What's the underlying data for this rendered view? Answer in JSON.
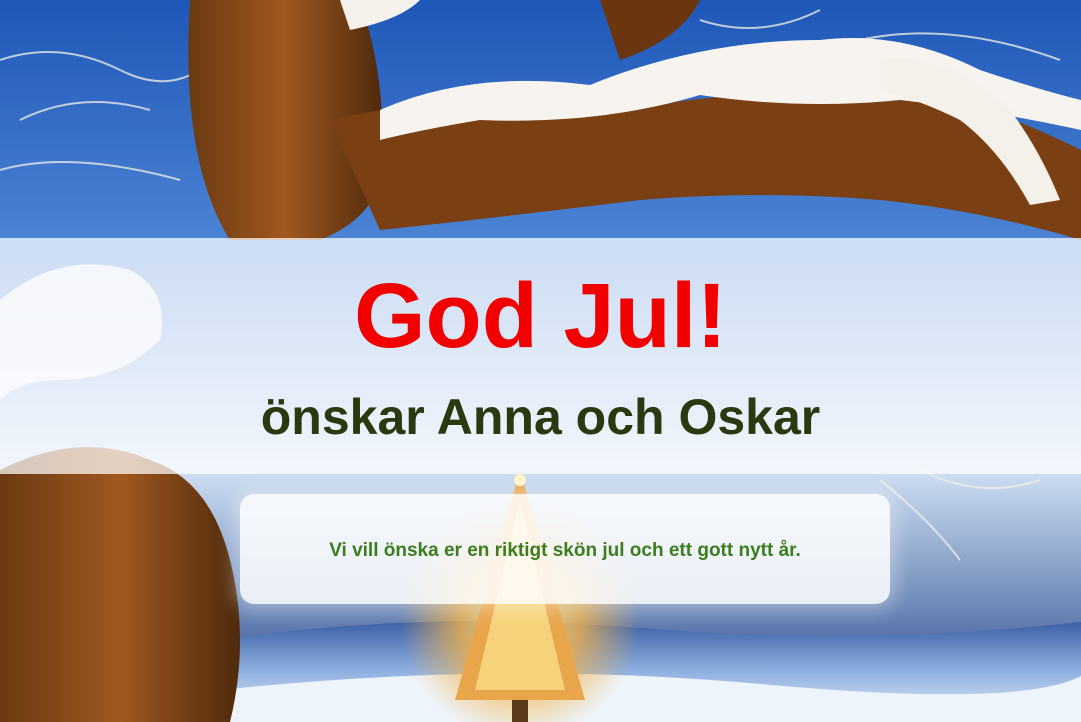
{
  "greeting": {
    "title": "God Jul!",
    "subtitle": "önskar Anna och Oskar"
  },
  "message": {
    "text": "Vi vill önska er en riktigt skön jul och ett gott nytt år."
  },
  "colors": {
    "title": "#f20000",
    "subtitle": "#2a3a10",
    "message": "#3b7d1f",
    "sky": "#2a5fb0"
  },
  "scene": {
    "description_icons": [
      "snowy-tree-icon",
      "christmas-tree-icon",
      "snow-field-icon"
    ]
  }
}
